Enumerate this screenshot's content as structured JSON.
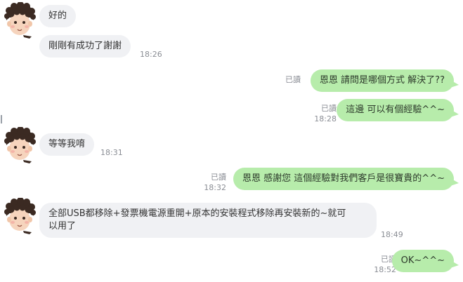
{
  "colors": {
    "incoming_bubble": "#f0f1f4",
    "outgoing_bubble": "#b7ecab",
    "meta_text": "#8a8d94"
  },
  "messages": [
    {
      "side": "in",
      "text": "好的",
      "time": "",
      "read": ""
    },
    {
      "side": "in",
      "text": "剛剛有成功了謝謝",
      "time": "18:26",
      "read": ""
    },
    {
      "side": "out",
      "text": "恩恩 請問是哪個方式 解決了??",
      "time": "",
      "read": "已讀"
    },
    {
      "side": "out",
      "text": "這邊 可以有個經驗^^~",
      "time": "18:28",
      "read": "已讀"
    },
    {
      "side": "in",
      "text": "等等我唷",
      "time": "18:31",
      "read": ""
    },
    {
      "side": "out",
      "text": "恩恩 感謝您 這個經驗對我們客戶是很寶貴的^^~",
      "time": "18:32",
      "read": "已讀"
    },
    {
      "side": "in",
      "text_line1": "全部USB都移除+發票機電源重開+原本的安裝程式移除再安裝新的~就可",
      "text_line2": "以用了",
      "time": "18:49",
      "read": ""
    },
    {
      "side": "out",
      "text": "OK~^^~",
      "time": "18:52",
      "read": "已讀"
    }
  ]
}
